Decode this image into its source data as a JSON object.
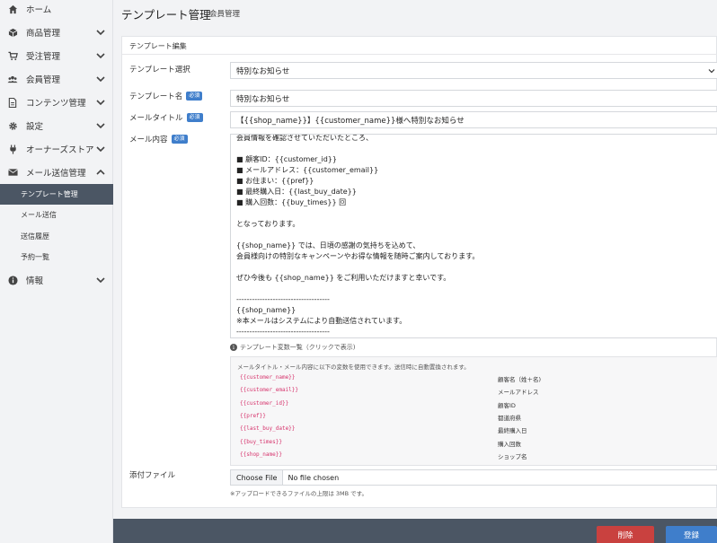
{
  "sidebar": {
    "items": [
      {
        "label": "ホーム",
        "icon": "home-icon"
      },
      {
        "label": "商品管理",
        "icon": "box-icon"
      },
      {
        "label": "受注管理",
        "icon": "cart-icon"
      },
      {
        "label": "会員管理",
        "icon": "users-icon"
      },
      {
        "label": "コンテンツ管理",
        "icon": "file-icon"
      },
      {
        "label": "設定",
        "icon": "gear-icon"
      },
      {
        "label": "オーナーズストア",
        "icon": "plug-icon"
      },
      {
        "label": "メール送信管理",
        "icon": "envelope-icon"
      }
    ],
    "sub_items": [
      {
        "label": "テンプレート管理",
        "active": true
      },
      {
        "label": "メール送信"
      },
      {
        "label": "送信履歴"
      },
      {
        "label": "予約一覧"
      }
    ],
    "info": {
      "label": "情報",
      "icon": "info-icon"
    }
  },
  "header": {
    "title": "テンプレート管理",
    "subtitle": "会員管理"
  },
  "card": {
    "title": "テンプレート編集"
  },
  "form": {
    "template_select": {
      "label": "テンプレート選択",
      "value": "特別なお知らせ"
    },
    "template_name": {
      "label": "テンプレート名",
      "badge": "必須",
      "value": "特別なお知らせ"
    },
    "mail_title": {
      "label": "メールタイトル",
      "badge": "必須",
      "value": "【{{shop_name}}】{{customer_name}}様へ特別なお知らせ"
    },
    "mail_body": {
      "label": "メール内容",
      "badge": "必須",
      "lines": [
        "会員情報を確認させていただいたところ、",
        "",
        "■ 顧客ID：{{customer_id}}",
        "■ メールアドレス：{{customer_email}}",
        "■ お住まい：{{pref}}",
        "■ 最終購入日：{{last_buy_date}}",
        "■ 購入回数：{{buy_times}} 回",
        "",
        "となっております。",
        "",
        "{{shop_name}} では、日頃の感謝の気持ちを込めて、",
        "会員様向けの特別なキャンペーンやお得な情報を随時ご案内しております。",
        "",
        "ぜひ今後も {{shop_name}} をご利用いただけますと幸いです。",
        "",
        "------------------------------------",
        "{{shop_name}}",
        "※本メールはシステムにより自動送信されています。",
        "------------------------------------"
      ]
    },
    "vars_toggle": "テンプレート変数一覧（クリックで表示)",
    "vars_desc": "メールタイトル・メール内容に以下の変数を使用できます。送信時に自動置換されます。",
    "vars": [
      {
        "name": "{{customer_name}}",
        "desc": "顧客名（姓＋名)"
      },
      {
        "name": "{{customer_email}}",
        "desc": "メールアドレス"
      },
      {
        "name": "{{customer_id}}",
        "desc": "顧客ID"
      },
      {
        "name": "{{pref}}",
        "desc": "都道府県"
      },
      {
        "name": "{{last_buy_date}}",
        "desc": "最終購入日"
      },
      {
        "name": "{{buy_times}}",
        "desc": "購入回数"
      },
      {
        "name": "{{shop_name}}",
        "desc": "ショップ名"
      }
    ],
    "attachment": {
      "label": "添付ファイル",
      "button": "Choose File",
      "status": "No file chosen",
      "note": "※アップロードできるファイルの上限は 3MB です。"
    }
  },
  "footer": {
    "delete_label": "削除",
    "register_label": "登録"
  },
  "colors": {
    "accent": "#3f7ecb",
    "danger": "#c9413f",
    "sidebar_active": "#4b5664",
    "variable": "#d6336c"
  }
}
